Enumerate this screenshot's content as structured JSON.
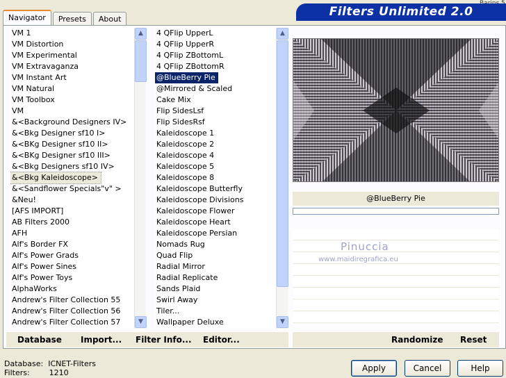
{
  "tabs": [
    "Navigator",
    "Presets",
    "About"
  ],
  "brand": "Filters Unlimited 2.0",
  "brand_corner": "Barins 5",
  "categories": [
    "VM 1",
    "VM Distortion",
    "VM Experimental",
    "VM Extravaganza",
    "VM Instant Art",
    "VM Natural",
    "VM Toolbox",
    "VM",
    "&<Background Designers IV>",
    "&<Bkg Designer sf10 I>",
    "&<BKg Designer sf10 II>",
    "&<BKg Designer sf10 III>",
    "&<Bkg Designers sf10 IV>",
    "&<Bkg Kaleidoscope>",
    "&<Sandflower Specials\"v\" >",
    "&Neu!",
    "[AFS IMPORT]",
    "AB Filters 2000",
    "AFH",
    "Alf's Border FX",
    "Alf's Power Grads",
    "Alf's Power Sines",
    "Alf's Power Toys",
    "AlphaWorks",
    "Andrew's Filter Collection 55",
    "Andrew's Filter Collection 56",
    "Andrew's Filter Collection 57"
  ],
  "selected_category": "&<Bkg Kaleidoscope>",
  "filters": [
    "4 QFlip UpperL",
    "4 QFlip UpperR",
    "4 QFlip ZBottomL",
    "4 QFlip ZBottomR",
    "@BlueBerry Pie",
    "@Mirrored & Scaled",
    "Cake Mix",
    "Flip SidesLsf",
    "Flip SidesRsf",
    "Kaleidoscope 1",
    "Kaleidoscope 2",
    "Kaleidoscope 4",
    "Kaleidoscope 5",
    "Kaleidoscope 8",
    "Kaleidoscope Butterfly",
    "Kaleidoscope Divisions",
    "Kaleidoscope Flower",
    "Kaleidoscope Heart",
    "Kaleidoscope Persian",
    "Nomads Rug",
    "Quad Flip",
    "Radial Mirror",
    "Radial Replicate",
    "Sands Plaid",
    "Swirl Away",
    "Tiler...",
    "Wallpaper Deluxe"
  ],
  "selected_filter": "@BlueBerry Pie",
  "filter_name": "@BlueBerry Pie",
  "watermark": {
    "name": "Pinuccia",
    "url": "www.maidiregrafica.eu"
  },
  "bottom_left": [
    "Database",
    "Import...",
    "Filter Info...",
    "Editor..."
  ],
  "bottom_right": [
    "Randomize",
    "Reset"
  ],
  "status": {
    "database_label": "Database:",
    "database_value": "ICNET-Filters",
    "filters_label": "Filters:",
    "filters_value": "1210"
  },
  "buttons": {
    "apply": "Apply",
    "cancel": "Cancel",
    "help": "Help"
  },
  "colors": {
    "accent": "#0b31a5",
    "selection": "#0a246a",
    "tab_accent": "#e68b2c"
  }
}
